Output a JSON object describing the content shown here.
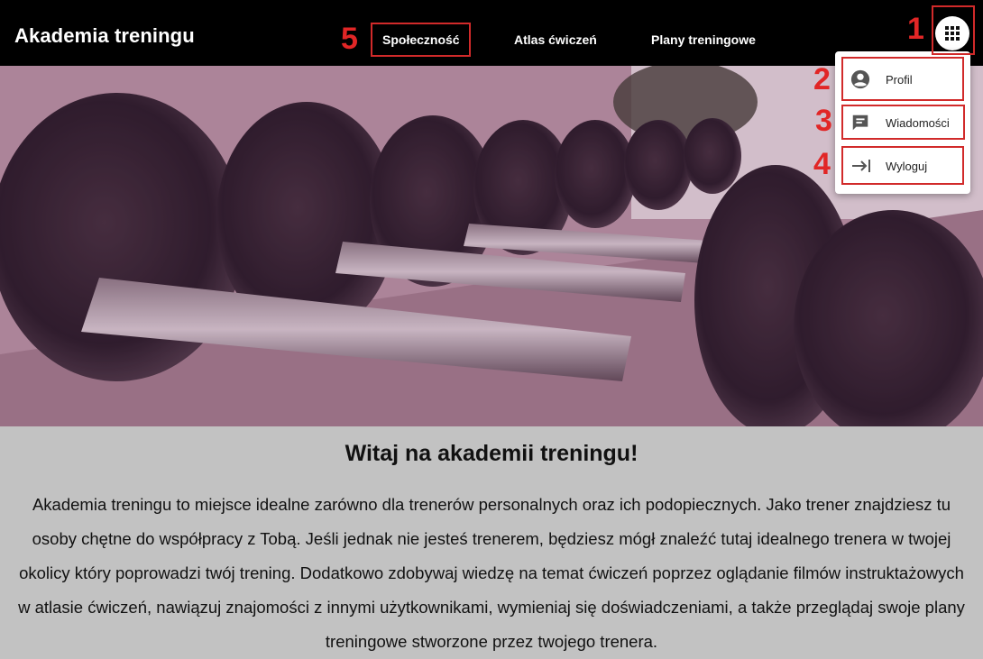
{
  "brand": "Akademia treningu",
  "nav": [
    "Społeczność",
    "Atlas ćwiczeń",
    "Plany treningowe"
  ],
  "markers": [
    "1",
    "2",
    "3",
    "4",
    "5"
  ],
  "menu": {
    "items": [
      {
        "label": "Profil",
        "icon": "account-circle-icon"
      },
      {
        "label": "Wiadomości",
        "icon": "message-icon"
      },
      {
        "label": "Wyloguj",
        "icon": "logout-arrow-icon"
      }
    ]
  },
  "apps_button": {
    "icon": "apps-grid-icon"
  },
  "hero": {
    "image": "dumbbell-rack-photo"
  },
  "content": {
    "title": "Witaj na akademii treningu!",
    "paragraph": "Akademia treningu to miejsce idealne zarówno dla trenerów personalnych oraz ich podopiecznych. Jako trener znajdziesz tu osoby chętne do współpracy z Tobą. Jeśli jednak nie jesteś trenerem, będziesz mógł znaleźć tutaj idealnego trenera w twojej okolicy który poprowadzi twój trening. Dodatkowo zdobywaj wiedzę na temat ćwiczeń poprzez oglądanie filmów instruktażowych w atlasie ćwiczeń, nawiązuj znajomości z innymi użytkownikami, wymieniaj się doświadczeniami, a także przeglądaj swoje plany treningowe stworzone przez twojego trenera."
  },
  "colors": {
    "topbar": "#000000",
    "annotation": "#d12a2a",
    "content_bg": "#c2c2c2"
  }
}
